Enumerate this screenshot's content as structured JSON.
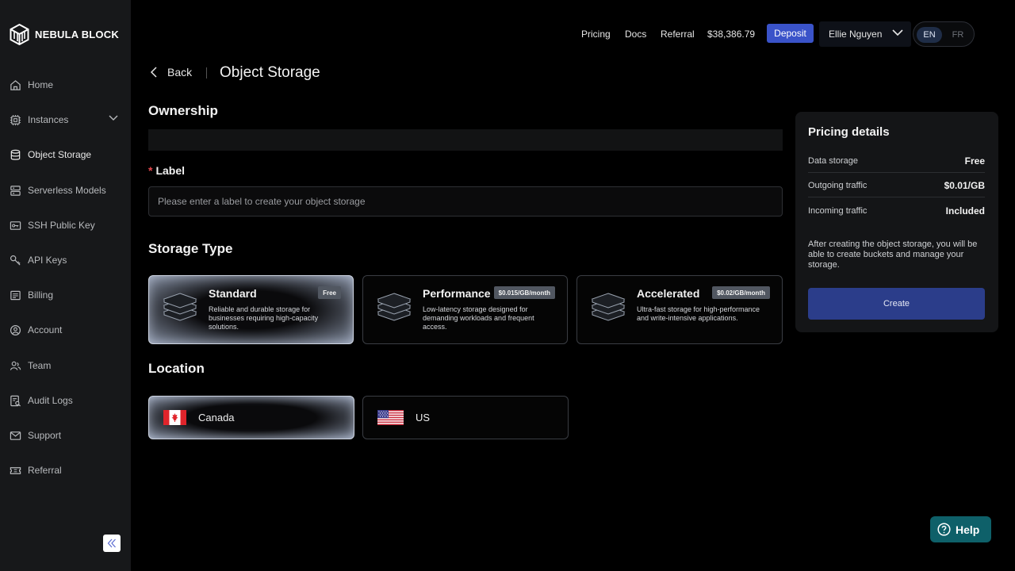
{
  "brand": {
    "name": "NEBULA BLOCK"
  },
  "sidebar": {
    "items": [
      {
        "label": "Home",
        "icon": "home-icon"
      },
      {
        "label": "Instances",
        "icon": "cpu-icon",
        "has_submenu": true
      },
      {
        "label": "Object Storage",
        "icon": "database-icon",
        "active": true
      },
      {
        "label": "Serverless Models",
        "icon": "server-icon"
      },
      {
        "label": "SSH Public Key",
        "icon": "key-card-icon"
      },
      {
        "label": "API Keys",
        "icon": "key-icon"
      },
      {
        "label": "Billing",
        "icon": "billing-icon"
      },
      {
        "label": "Account",
        "icon": "user-circle-icon"
      },
      {
        "label": "Team",
        "icon": "team-icon"
      },
      {
        "label": "Audit Logs",
        "icon": "audit-icon"
      },
      {
        "label": "Support",
        "icon": "mail-icon"
      },
      {
        "label": "Referral",
        "icon": "ticket-icon"
      }
    ]
  },
  "topbar": {
    "pricing": "Pricing",
    "docs": "Docs",
    "referral": "Referral",
    "balance": "$38,386.79",
    "deposit": "Deposit",
    "user_name": "Ellie Nguyen",
    "lang_en": "EN",
    "lang_fr": "FR"
  },
  "header": {
    "back": "Back",
    "title": "Object Storage"
  },
  "ownership": {
    "heading": "Ownership"
  },
  "label_field": {
    "required_mark": "*",
    "heading": "Label",
    "value": "",
    "placeholder": "Please enter a label to create your object storage"
  },
  "storage_type": {
    "heading": "Storage Type",
    "options": [
      {
        "title": "Standard",
        "badge": "Free",
        "desc": "Reliable and durable storage for businesses requiring high-capacity solutions.",
        "selected": true
      },
      {
        "title": "Performance",
        "badge": "$0.015/GB/month",
        "desc": "Low-latency storage designed for demanding workloads and frequent access.",
        "selected": false
      },
      {
        "title": "Accelerated",
        "badge": "$0.02/GB/month",
        "desc": "Ultra-fast storage for high-performance and write-intensive applications.",
        "selected": false
      }
    ]
  },
  "location": {
    "heading": "Location",
    "options": [
      {
        "label": "Canada",
        "flag": "canada-flag-icon",
        "selected": true
      },
      {
        "label": "US",
        "flag": "us-flag-icon",
        "selected": false
      }
    ]
  },
  "pricing_details": {
    "title": "Pricing details",
    "rows": [
      {
        "key": "Data storage",
        "value": "Free"
      },
      {
        "key": "Outgoing traffic",
        "value": "$0.01/GB"
      },
      {
        "key": "Incoming traffic",
        "value": "Included"
      }
    ],
    "note": "After creating the object storage, you will be able to create buckets and manage your storage.",
    "create": "Create"
  },
  "help": {
    "label": "Help"
  },
  "colors": {
    "accent": "#3a53c9",
    "create_button": "#2b3d8a",
    "help_button": "#0e6069",
    "required": "#e5484d"
  }
}
